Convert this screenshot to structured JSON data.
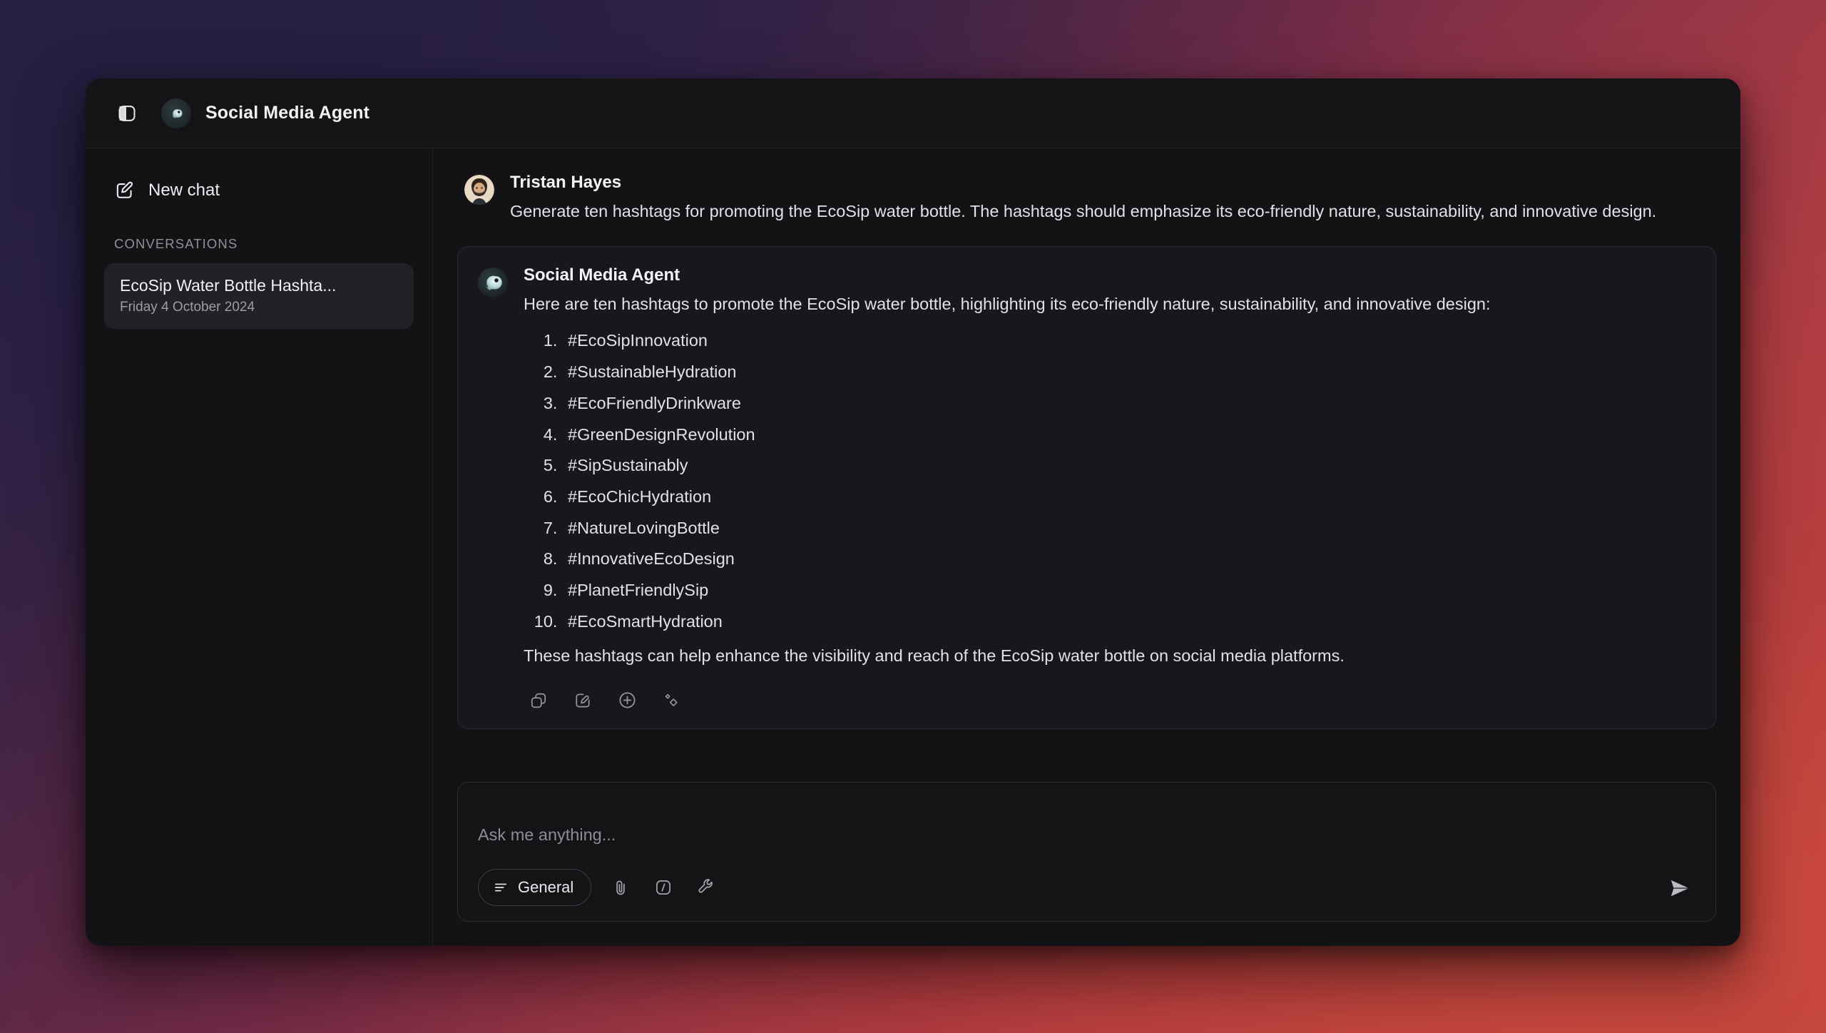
{
  "titlebar": {
    "sidebar_toggle_icon": "sidebar-toggle-icon",
    "agent_avatar_icon": "agent-bird-logo-icon",
    "title": "Social Media Agent"
  },
  "sidebar": {
    "new_chat": {
      "label": "New chat",
      "icon": "compose-pencil-icon"
    },
    "section_label": "CONVERSATIONS",
    "conversations": [
      {
        "title": "EcoSip Water Bottle Hashta...",
        "date": "Friday 4 October 2024",
        "selected": true
      }
    ]
  },
  "thread": {
    "user_message": {
      "author": "Tristan Hayes",
      "avatar": "user-photo-avatar",
      "text": "Generate ten hashtags for promoting the EcoSip water bottle. The hashtags should emphasize its eco-friendly nature, sustainability, and innovative design."
    },
    "agent_message": {
      "author": "Social Media Agent",
      "avatar": "agent-bird-logo-icon",
      "intro": "Here are ten hashtags to promote the EcoSip water bottle, highlighting its eco-friendly nature, sustainability, and innovative design:",
      "hashtags": [
        "#EcoSipInnovation",
        "#SustainableHydration",
        "#EcoFriendlyDrinkware",
        "#GreenDesignRevolution",
        "#SipSustainably",
        "#EcoChicHydration",
        "#NatureLovingBottle",
        "#InnovativeEcoDesign",
        "#PlanetFriendlySip",
        "#EcoSmartHydration"
      ],
      "closing": "These hashtags can help enhance the visibility and reach of the EcoSip water bottle on social media platforms.",
      "actions": [
        {
          "name": "copy-icon",
          "title": "Copy"
        },
        {
          "name": "edit-note-icon",
          "title": "Edit"
        },
        {
          "name": "plus-circle-icon",
          "title": "Add"
        },
        {
          "name": "sparkles-icon",
          "title": "Enhance"
        }
      ]
    }
  },
  "composer": {
    "placeholder": "Ask me anything...",
    "value": "",
    "mode_chip": {
      "label": "General",
      "icon": "list-lines-icon"
    },
    "tools": [
      {
        "name": "attachment-paperclip-icon",
        "title": "Attach file"
      },
      {
        "name": "slash-command-icon",
        "title": "Slash commands"
      },
      {
        "name": "wrench-tools-icon",
        "title": "Tools"
      }
    ],
    "send_icon": "send-paper-plane-icon"
  },
  "colors": {
    "window_bg": "#131316",
    "card_bg": "#18181c",
    "border": "#282a2e",
    "selected_item": "#212126",
    "text_primary": "#f2f2f4",
    "text_secondary": "#9b9ea3",
    "desktop_gradient_start": "#221c3c",
    "desktop_gradient_end": "#c44a42"
  }
}
